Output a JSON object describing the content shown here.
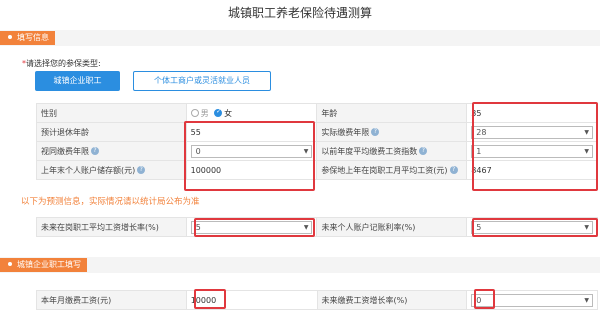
{
  "page_title": "城镇职工养老保险待遇测算",
  "sections": {
    "info": "填写信息",
    "employee": "城镇企业职工填写"
  },
  "prompt": {
    "star": "*",
    "text": "请选择您的参保类型:"
  },
  "type_buttons": {
    "active": "城镇企业职工",
    "inactive": "个体工商户或灵活就业人员"
  },
  "form": {
    "gender_label": "性别",
    "gender_male": "男",
    "gender_female": "女",
    "age_label": "年龄",
    "age_value": "35",
    "retire_age_label": "预计退休年龄",
    "retire_age_value": "55",
    "actual_years_label": "实际缴费年限",
    "actual_years_value": "28",
    "deemed_years_label": "视同缴费年限",
    "deemed_years_value": "0",
    "prev_index_label": "以前年度平均缴费工资指数",
    "prev_index_value": "1",
    "balance_label": "上年末个人账户储存额(元)",
    "balance_value": "100000",
    "avg_wage_label": "参保地上年在岗职工月平均工资(元)",
    "avg_wage_value": "8467"
  },
  "forecast_note": "以下为预测信息，实际情况请以统计局公布为准",
  "forecast": {
    "wage_growth_label": "未来在岗职工平均工资增长率(%)",
    "wage_growth_value": "5",
    "account_rate_label": "未来个人账户记账利率(%)",
    "account_rate_value": "5"
  },
  "employee": {
    "monthly_wage_label": "本年月缴费工资(元)",
    "monthly_wage_value": "10000",
    "wage_growth_label": "未来缴费工资增长率(%)",
    "wage_growth_value": "0"
  },
  "icons": {
    "help": "?",
    "dropdown": "▼"
  },
  "colors": {
    "accent_orange": "#f2823b",
    "accent_blue": "#2b8ee0",
    "highlight_red": "#e0383e"
  }
}
